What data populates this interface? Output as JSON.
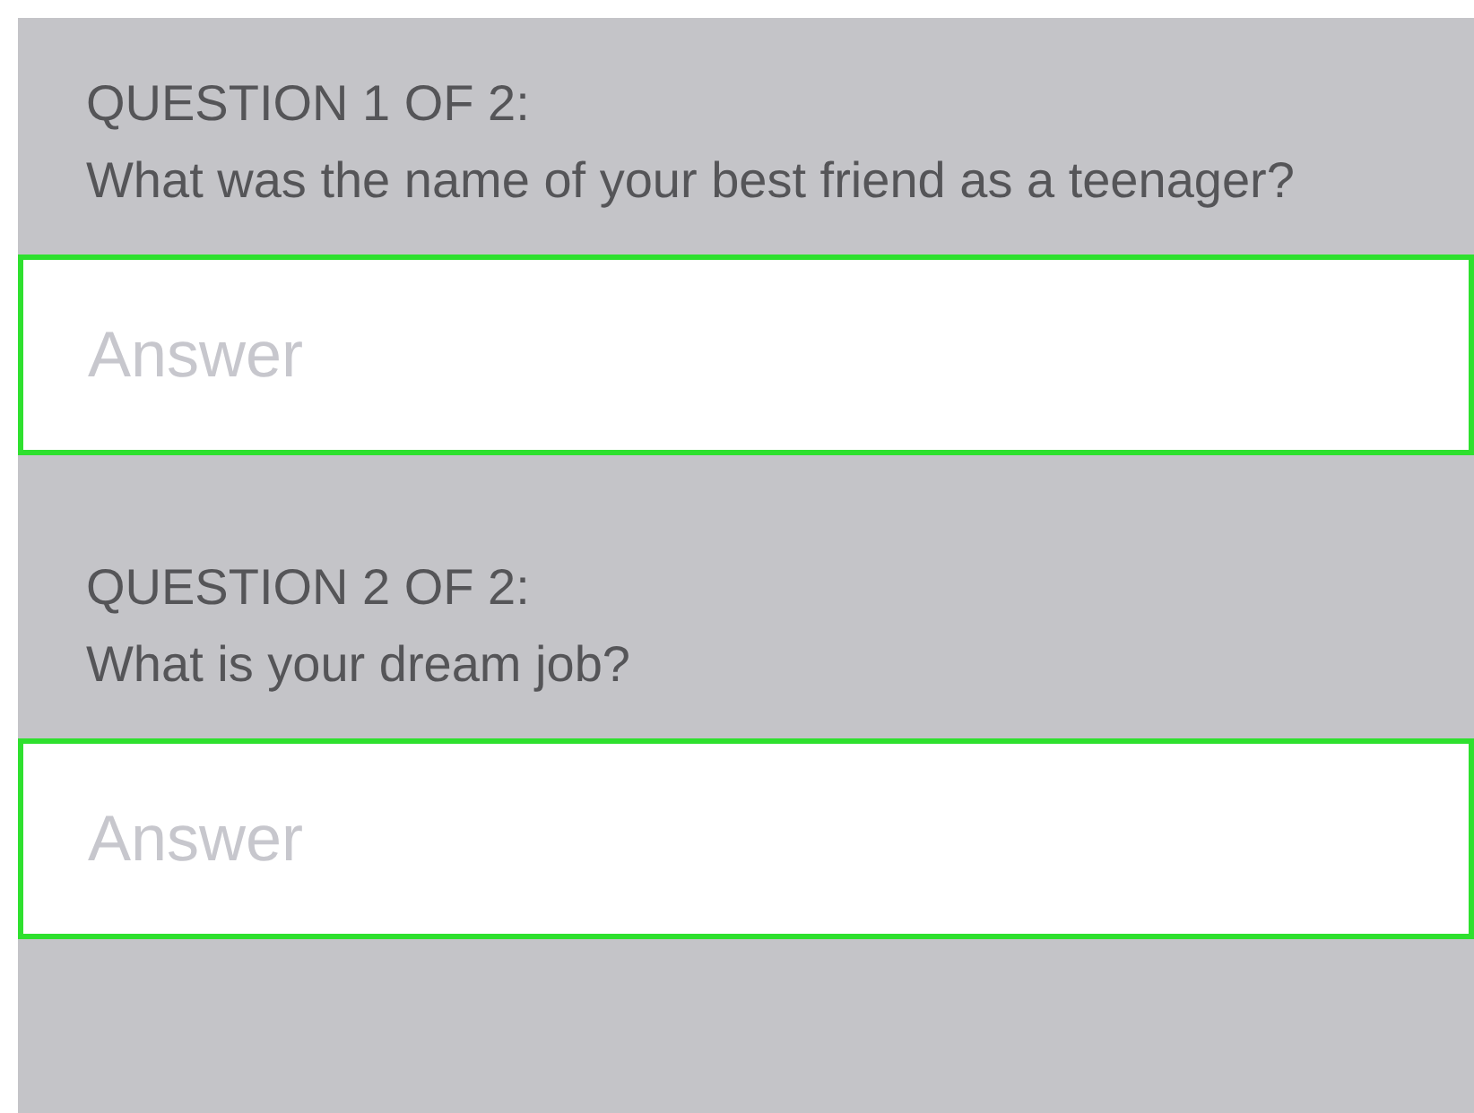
{
  "questions": [
    {
      "label": "QUESTION 1 OF 2:",
      "text": "What was the name of your best friend as a teenager?",
      "answer": {
        "placeholder": "Answer",
        "highlighted": true
      }
    },
    {
      "label": "QUESTION 2 OF 2:",
      "text": "What is your dream job?",
      "answer": {
        "placeholder": "Answer",
        "highlighted": true
      }
    }
  ]
}
